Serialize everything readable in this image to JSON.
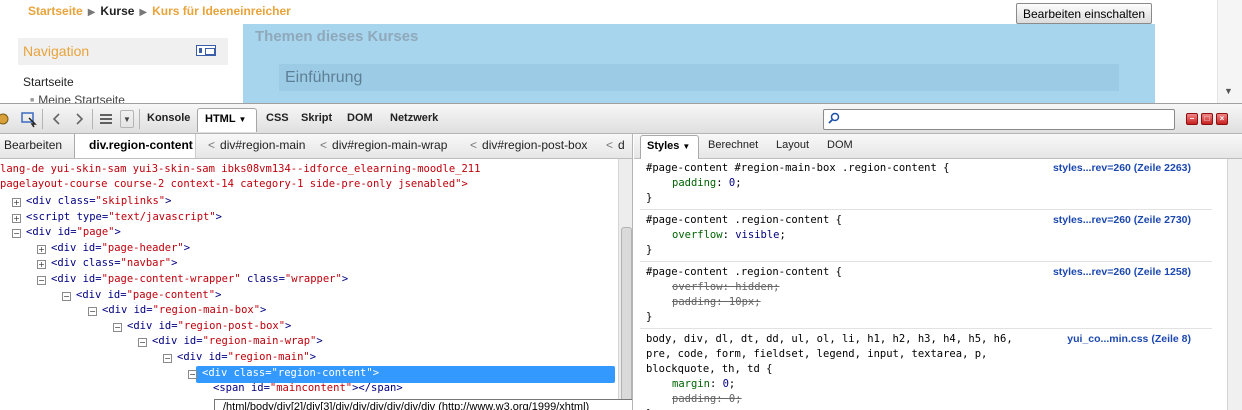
{
  "page": {
    "breadcrumb": [
      {
        "label": "Startseite",
        "type": "link"
      },
      {
        "label": "Kurse",
        "type": "current"
      },
      {
        "label": "Kurs für Ideeneinreicher",
        "type": "link"
      }
    ],
    "edit_button": "Bearbeiten einschalten",
    "navigation": {
      "title": "Navigation",
      "items": [
        "Startseite",
        "Meine Startseite"
      ]
    },
    "content_heading": "Themen dieses Kurses",
    "section_title": "Einführung",
    "colors": {
      "accent": "#e8a33a",
      "highlight": "#a7d5ee"
    }
  },
  "firebug": {
    "toolbar": {
      "icons": [
        "firebug-icon",
        "inspect-icon",
        "back-icon",
        "forward-icon",
        "list-icon",
        "dropdown-icon"
      ],
      "tabs": [
        "Konsole",
        "HTML",
        "CSS",
        "Skript",
        "DOM",
        "Netzwerk"
      ],
      "active_tab": "HTML",
      "search_value": "",
      "window_buttons": [
        "minimize",
        "restore",
        "close"
      ]
    },
    "left": {
      "edit_label": "Bearbeiten",
      "breadcrumb": [
        "div.region-content",
        "div#region-main",
        "div#region-main-wrap",
        "div#region-post-box",
        "d"
      ],
      "tree_top_text": [
        "lang-de yui-skin-sam yui3-skin-sam ibks08vm134--idforce_elearning-moodle_211",
        "pagelayout-course course-2 context-14 category-1 side-pre-only jsenabled\">"
      ],
      "tree": [
        {
          "tw": "+",
          "tag": "div",
          "attr": "class",
          "val": "skiplinks",
          "suffix": ">"
        },
        {
          "tw": "+",
          "tag": "script",
          "attr": "type",
          "val": "text/javascript",
          "suffix": ">"
        },
        {
          "tw": "-",
          "tag": "div",
          "attr": "id",
          "val": "page",
          "suffix": ">"
        },
        {
          "tw": "+",
          "tag": "div",
          "attr": "id",
          "val": "page-header",
          "suffix": ">"
        },
        {
          "tw": "+",
          "tag": "div",
          "attr": "class",
          "val": "navbar",
          "suffix": ">"
        },
        {
          "tw": "-",
          "tag": "div",
          "attr": "id",
          "val": "page-content-wrapper",
          "attr2": "class",
          "val2": "wrapper",
          "suffix": ">"
        },
        {
          "tw": "-",
          "tag": "div",
          "attr": "id",
          "val": "page-content",
          "suffix": ">"
        },
        {
          "tw": "-",
          "tag": "div",
          "attr": "id",
          "val": "region-main-box",
          "suffix": ">"
        },
        {
          "tw": "-",
          "tag": "div",
          "attr": "id",
          "val": "region-post-box",
          "suffix": ">"
        },
        {
          "tw": "-",
          "tag": "div",
          "attr": "id",
          "val": "region-main-wrap",
          "suffix": ">"
        },
        {
          "tw": "-",
          "tag": "div",
          "attr": "id",
          "val": "region-main",
          "suffix": ">"
        },
        {
          "tw": "-",
          "tag": "div",
          "attr": "class",
          "val": "region-content",
          "suffix": ">"
        },
        {
          "tw": "",
          "tag": "span",
          "attr": "id",
          "val": "maincontent",
          "suffix": "></span>"
        }
      ],
      "tooltip": "/html/body/div[2]/div[3]/div/div/div/div/div/div (http://www.w3.org/1999/xhtml)"
    },
    "right": {
      "tabs": [
        "Styles",
        "Berechnet",
        "Layout",
        "DOM"
      ],
      "active_tab": "Styles",
      "rules": [
        {
          "selector": "#page-content #region-main-box .region-content {",
          "source": "styles...rev=260 (Zeile 2263)",
          "props": [
            {
              "name": "padding",
              "value": "0",
              "overridden": false
            }
          ]
        },
        {
          "selector": "#page-content .region-content {",
          "source": "styles...rev=260 (Zeile 2730)",
          "props": [
            {
              "name": "overflow",
              "value": "visible",
              "overridden": false
            }
          ]
        },
        {
          "selector": "#page-content .region-content {",
          "source": "styles...rev=260 (Zeile 1258)",
          "props": [
            {
              "name": "overflow",
              "value": "hidden",
              "overridden": true
            },
            {
              "name": "padding",
              "value": "10px",
              "overridden": true
            }
          ]
        },
        {
          "selector_lines": [
            "body, div, dl, dt, dd, ul, ol, li, h1, h2, h3, h4, h5, h6,",
            "pre, code, form, fieldset, legend, input, textarea, p,",
            "blockquote, th, td {"
          ],
          "source": "yui_co...min.css (Zeile 8)",
          "props": [
            {
              "name": "margin",
              "value": "0",
              "overridden": false
            },
            {
              "name": "padding",
              "value": "0",
              "overridden": true
            }
          ]
        }
      ]
    }
  }
}
